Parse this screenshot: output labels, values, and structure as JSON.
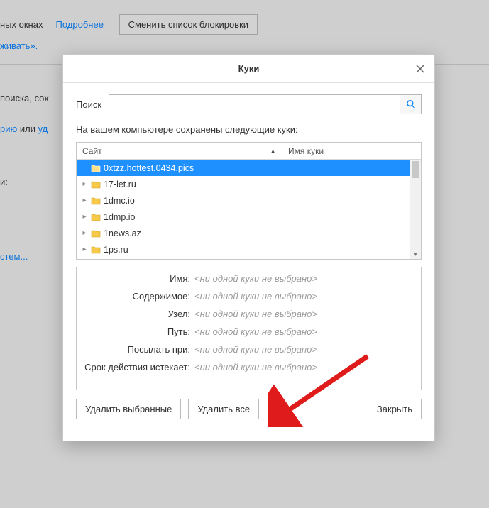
{
  "bg": {
    "line1_text": "ных окнах",
    "link_details": "Подробнее",
    "change_blocklist": "Сменить список блокировки",
    "line2_text": "живать».",
    "line3_text": "поиска, сох",
    "link_hist_part": "рию",
    "line4_or": "или",
    "link_del_part": "уд",
    "line5_text": "и:",
    "link_cert": "стем..."
  },
  "dialog": {
    "title": "Куки",
    "search_label": "Поиск",
    "intro": "На вашем компьютере сохранены следующие куки:",
    "col_site": "Сайт",
    "col_name": "Имя куки",
    "sites": [
      "0xtzz.hottest.0434.pics",
      "17-let.ru",
      "1dmc.io",
      "1dmp.io",
      "1news.az",
      "1ps.ru"
    ],
    "selected_index": 0,
    "details": {
      "no_sel": "<ни одной куки не выбрано>",
      "labels": {
        "name": "Имя:",
        "content": "Содержимое:",
        "host": "Узел:",
        "path": "Путь:",
        "send": "Посылать при:",
        "expires": "Срок действия истекает:"
      }
    },
    "buttons": {
      "remove_selected": "Удалить выбранные",
      "remove_all": "Удалить все",
      "close": "Закрыть"
    }
  }
}
